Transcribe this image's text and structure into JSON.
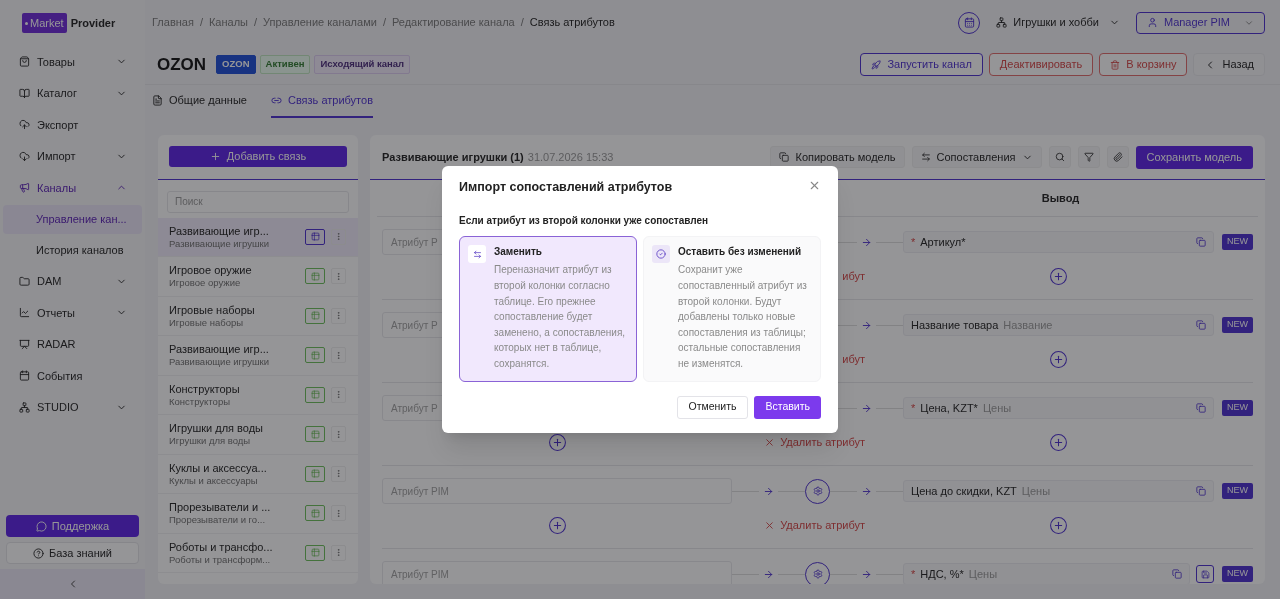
{
  "logo": {
    "badge": "Market",
    "text": "Provider"
  },
  "sidebar": {
    "items": [
      {
        "label": "Товары",
        "kind": "bag",
        "expandable": true,
        "expanded": false,
        "selected": false
      },
      {
        "label": "Каталог",
        "kind": "book",
        "expandable": true,
        "expanded": false,
        "selected": false
      },
      {
        "label": "Экспорт",
        "kind": "export",
        "expandable": false,
        "selected": false
      },
      {
        "label": "Импорт",
        "kind": "import",
        "expandable": true,
        "expanded": false,
        "selected": false
      },
      {
        "label": "Каналы",
        "kind": "channels",
        "expandable": true,
        "expanded": true,
        "selected": true,
        "children": [
          {
            "label": "Управление кан...",
            "selected": true
          },
          {
            "label": "История каналов",
            "selected": false
          }
        ]
      },
      {
        "label": "DAM",
        "kind": "folder",
        "expandable": true,
        "expanded": false,
        "selected": false
      },
      {
        "label": "Отчеты",
        "kind": "chart",
        "expandable": true,
        "expanded": false,
        "selected": false
      },
      {
        "label": "RADAR",
        "kind": "radar",
        "expandable": false,
        "selected": false
      },
      {
        "label": "События",
        "kind": "calendar",
        "expandable": false,
        "selected": false
      },
      {
        "label": "STUDIO",
        "kind": "studio",
        "expandable": true,
        "expanded": false,
        "selected": false
      }
    ],
    "support": "Поддержка",
    "knowledge": "База знаний"
  },
  "breadcrumbs": {
    "separator": "/",
    "items": [
      "Главная",
      "Каналы",
      "Управление каналами",
      "Редактирование канала",
      "Связь атрибутов"
    ]
  },
  "header": {
    "category": "Игрушки и хобби",
    "user": "Manager PIM"
  },
  "channel": {
    "title": "OZON",
    "badges": [
      {
        "label": "OZON",
        "kind": "brand"
      },
      {
        "label": "Активен",
        "kind": "success"
      },
      {
        "label": "Исходящий канал",
        "kind": "info"
      }
    ],
    "actions": [
      {
        "label": "Запустить канал",
        "kind": "launch"
      },
      {
        "label": "Деактивировать",
        "kind": "deactivate"
      },
      {
        "label": "В корзину",
        "kind": "trash"
      },
      {
        "label": "Назад",
        "kind": "back"
      }
    ]
  },
  "tabs": [
    {
      "label": "Общие данные",
      "selected": false
    },
    {
      "label": "Связь атрибутов",
      "selected": true
    }
  ],
  "groups": {
    "add_button": "Добавить связь",
    "search_placeholder": "Поиск",
    "items": [
      {
        "title": "Развивающие игр...",
        "subtitle": "Развивающие игрушки",
        "selected": true
      },
      {
        "title": "Игровое оружие",
        "subtitle": "Игровое оружие",
        "selected": false
      },
      {
        "title": "Игровые наборы",
        "subtitle": "Игровые наборы",
        "selected": false
      },
      {
        "title": "Развивающие игр...",
        "subtitle": "Развивающие игрушки",
        "selected": false
      },
      {
        "title": "Конструкторы",
        "subtitle": "Конструкторы",
        "selected": false
      },
      {
        "title": "Игрушки для воды",
        "subtitle": "Игрушки для воды",
        "selected": false
      },
      {
        "title": "Куклы и аксессуа...",
        "subtitle": "Куклы и аксессуары",
        "selected": false
      },
      {
        "title": "Прорезыватели и ...",
        "subtitle": "Прорезыватели и го...",
        "selected": false
      },
      {
        "title": "Роботы и трансфо...",
        "subtitle": "Роботы и трансформ...",
        "selected": false
      }
    ]
  },
  "mapping": {
    "title": "Развивающие игрушки (1)",
    "date": "31.07.2026 15:33",
    "copy_button": "Копировать модель",
    "mappings_button": "Сопоставления",
    "save_button": "Сохранить модель",
    "output_header": "Вывод",
    "required_mark": "*",
    "rows": [
      {
        "input_placeholder": "Атрибут P",
        "gear": false,
        "required": true,
        "name": "Артикул*",
        "badge": "NEW",
        "add_input": false,
        "delete_label": "ибут",
        "delete_icon": false,
        "extra_button": false
      },
      {
        "input_placeholder": "Атрибут P",
        "gear": false,
        "required": false,
        "name": "Название товара",
        "group": "Название",
        "badge": "NEW",
        "add_input": false,
        "delete_label": "ибут",
        "delete_icon": false,
        "extra_button": false
      },
      {
        "input_placeholder": "Атрибут P",
        "gear": false,
        "required": true,
        "name": "Цена, KZT*",
        "group": "Цены",
        "badge": "NEW",
        "add_input": true,
        "delete_label": "Удалить атрибут",
        "delete_icon": true,
        "extra_button": false
      },
      {
        "input_placeholder": "Атрибут PIM",
        "gear": true,
        "required": false,
        "name": "Цена до скидки, KZT",
        "group": "Цены",
        "badge": "NEW",
        "add_input": true,
        "delete_label": "Удалить атрибут",
        "delete_icon": true,
        "extra_button": false
      },
      {
        "input_placeholder": "Атрибут PIM",
        "gear": true,
        "required": true,
        "name": "НДС, %*",
        "group": "Цены",
        "badge": "NEW",
        "extra_button": true
      }
    ]
  },
  "modal": {
    "title": "Импорт сопоставлений атрибутов",
    "question": "Если атрибут из второй колонки уже сопоставлен",
    "options": [
      {
        "kind": "replace",
        "title": "Заменить",
        "description": "Переназначит атрибут из второй колонки согласно таблице. Его прежнее сопоставление будет заменено, а сопоставления, которых нет в таблице, сохранятся.",
        "selected": true
      },
      {
        "kind": "keep",
        "title": "Оставить без изменений",
        "description": "Сохранит уже сопоставленный атрибут из второй колонки. Будут добавлены только новые сопоставления из таблицы; остальные сопоставления не изменятся.",
        "selected": false
      }
    ],
    "cancel": "Отменить",
    "confirm": "Вставить"
  }
}
